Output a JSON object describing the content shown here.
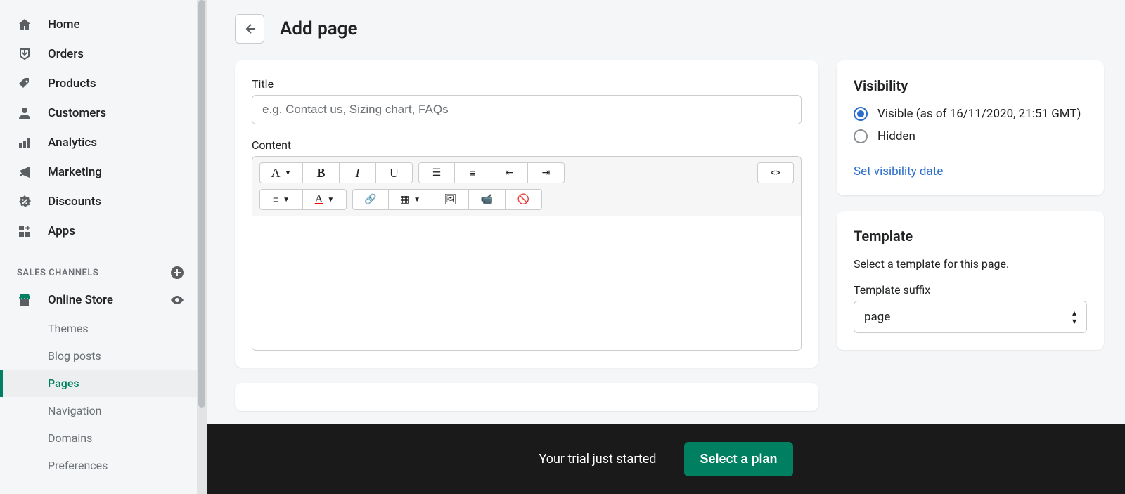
{
  "sidebar": {
    "items": [
      {
        "label": "Home",
        "icon": "home"
      },
      {
        "label": "Orders",
        "icon": "orders"
      },
      {
        "label": "Products",
        "icon": "products"
      },
      {
        "label": "Customers",
        "icon": "customers"
      },
      {
        "label": "Analytics",
        "icon": "analytics"
      },
      {
        "label": "Marketing",
        "icon": "marketing"
      },
      {
        "label": "Discounts",
        "icon": "discounts"
      },
      {
        "label": "Apps",
        "icon": "apps"
      }
    ],
    "section_label": "SALES CHANNELS",
    "channel_label": "Online Store",
    "sub_items": [
      {
        "label": "Themes"
      },
      {
        "label": "Blog posts"
      },
      {
        "label": "Pages",
        "active": true
      },
      {
        "label": "Navigation"
      },
      {
        "label": "Domains"
      },
      {
        "label": "Preferences"
      }
    ]
  },
  "header": {
    "title": "Add page"
  },
  "form": {
    "title_label": "Title",
    "title_placeholder": "e.g. Contact us, Sizing chart, FAQs",
    "content_label": "Content"
  },
  "visibility": {
    "heading": "Visibility",
    "visible_label": "Visible (as of 16/11/2020, 21:51 GMT)",
    "hidden_label": "Hidden",
    "link_label": "Set visibility date"
  },
  "template": {
    "heading": "Template",
    "helper": "Select a template for this page.",
    "suffix_label": "Template suffix",
    "selected": "page"
  },
  "banner": {
    "text": "Your trial just started",
    "button": "Select a plan"
  }
}
